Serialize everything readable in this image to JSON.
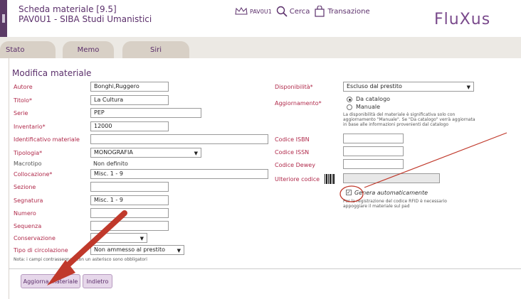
{
  "header": {
    "title": "Scheda materiale [9.5]",
    "subtitle": "PAV0U1 - SIBA Studi Umanistici",
    "library_code": "PAV0U1",
    "search_label": "Cerca",
    "transactions_label": "Transazione",
    "logo": "FluXus"
  },
  "tabs": [
    {
      "label": "Stato"
    },
    {
      "label": "Memo"
    },
    {
      "label": "Siri"
    }
  ],
  "form": {
    "title": "Modifica materiale",
    "autore": {
      "label": "Autore",
      "value": "Bonghi,Ruggero"
    },
    "titolo": {
      "label": "Titolo*",
      "value": "La Cultura"
    },
    "serie": {
      "label": "Serie",
      "value": "PEP"
    },
    "inventario": {
      "label": "Inventario*",
      "value": "12000"
    },
    "identificativo": {
      "label": "Identificativo materiale",
      "value": ""
    },
    "tipologia": {
      "label": "Tipologia*",
      "value": "MONOGRAFIA"
    },
    "macrotipo": {
      "label": "Macrotipo",
      "value": "Non definito"
    },
    "collocazione": {
      "label": "Collocazione*",
      "value": "Misc. 1 - 9"
    },
    "sezione": {
      "label": "Sezione",
      "value": ""
    },
    "segnatura": {
      "label": "Segnatura",
      "value": "Misc. 1 - 9"
    },
    "numero": {
      "label": "Numero",
      "value": ""
    },
    "sequenza": {
      "label": "Sequenza",
      "value": ""
    },
    "conservazione": {
      "label": "Conservazione",
      "value": ""
    },
    "tipo_circolazione": {
      "label": "Tipo di circolazione",
      "value": "Non ammesso al prestito"
    },
    "note": "Nota: i campi contrassegnati con un asterisco sono obbligatori",
    "disponibilita": {
      "label": "Disponibilità*",
      "value": "Escluso dal prestito"
    },
    "aggiornamento": {
      "label": "Aggiornamento*",
      "option_catalogo": "Da catalogo",
      "option_manuale": "Manuale",
      "selected": "Da catalogo"
    },
    "disponibilita_note": [
      "La disponibilità del materiale è significativa solo con",
      "aggiornamento \"Manuale\". Se \"Da catalogo\" verrà aggiornata",
      "in base alle informazioni provenienti dal catalogo"
    ],
    "isbn": {
      "label": "Codice ISBN",
      "value": ""
    },
    "issn": {
      "label": "Codice ISSN",
      "value": ""
    },
    "dewey": {
      "label": "Codice Dewey",
      "value": ""
    },
    "ulteriore": {
      "label": "Ulteriore codice",
      "value": ""
    },
    "genera": {
      "label": "Genera automaticamente",
      "checked": true
    },
    "rfid_note": [
      "Per la registrazione del codice RFID è necessario",
      "appoggiare il materiale sul pad"
    ]
  },
  "buttons": {
    "update": "Aggiorna materiale",
    "back": "Indietro"
  },
  "colors": {
    "brand": "#5b2f6b",
    "required_label": "#b0294a",
    "annotation": "#c0392b"
  }
}
